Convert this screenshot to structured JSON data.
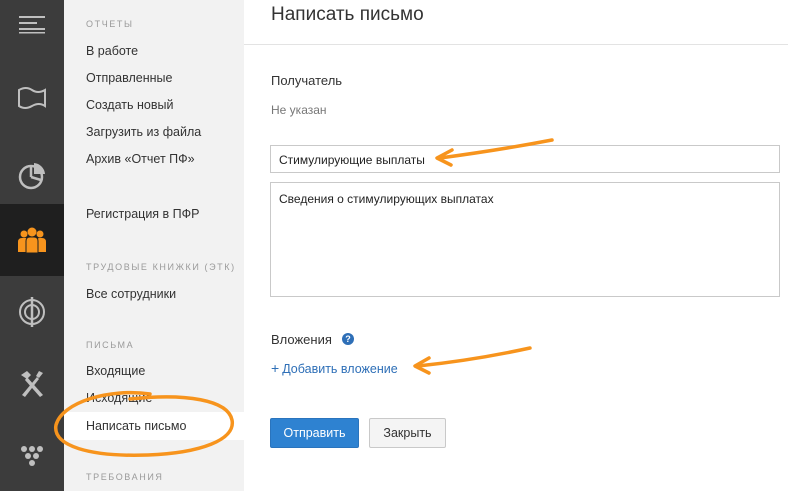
{
  "rail": {
    "items": [
      {
        "icon": "menu-icon"
      },
      {
        "icon": "flag-icon"
      },
      {
        "icon": "pie-chart-icon"
      },
      {
        "icon": "people-icon",
        "active": true
      },
      {
        "icon": "target-icon"
      },
      {
        "icon": "tools-icon"
      },
      {
        "icon": "grapes-icon"
      }
    ]
  },
  "sidebar": {
    "section_reports": "Отчеты",
    "in_progress": "В работе",
    "sent": "Отправленные",
    "create_new": "Создать новый",
    "upload_file": "Загрузить из файла",
    "archive": "Архив «Отчет ПФ»",
    "registration": "Регистрация в ПФР",
    "section_workbooks": "Трудовые книжки (ЭТК)",
    "all_employees": "Все сотрудники",
    "section_letters": "Письма",
    "incoming": "Входящие",
    "outgoing": "Исходящие",
    "write_letter": "Написать письмо",
    "section_requirements": "Требования"
  },
  "form": {
    "title": "Написать письмо",
    "recipient_label": "Получатель",
    "recipient_value": "Не указан",
    "subject_value": "Стимулирующие выплаты",
    "body_value": "Сведения о стимулирующих выплатах",
    "attachments_label": "Вложения",
    "help_glyph": "?",
    "add_attachment_plus": "+",
    "add_attachment": "Добавить вложение",
    "send_button": "Отправить",
    "close_button": "Закрыть"
  },
  "colors": {
    "accent_orange": "#f7941d",
    "link_blue": "#2e6fb7",
    "button_blue": "#2e82d1",
    "rail_bg": "#3c3c3c",
    "rail_active_bg": "#1f1f1f"
  }
}
